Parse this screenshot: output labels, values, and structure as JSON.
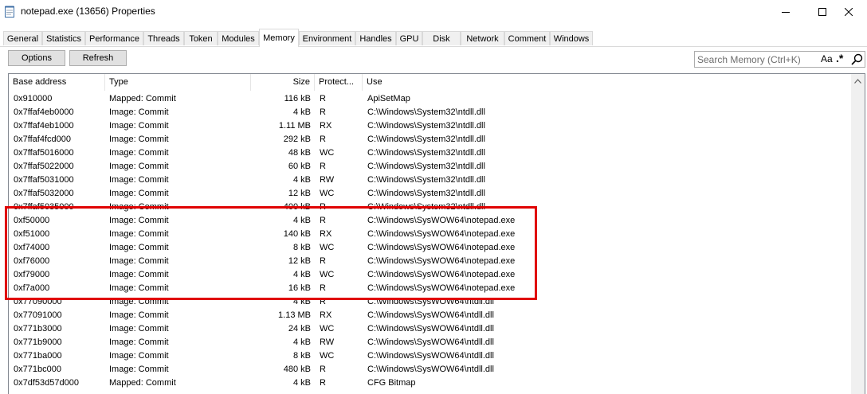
{
  "window": {
    "title": "notepad.exe (13656) Properties",
    "icon": "notepad-app-icon",
    "controls": [
      "minimize-icon",
      "maximize-icon",
      "close-icon"
    ]
  },
  "tabs": [
    {
      "label": "General"
    },
    {
      "label": "Statistics"
    },
    {
      "label": "Performance"
    },
    {
      "label": "Threads"
    },
    {
      "label": "Token"
    },
    {
      "label": "Modules"
    },
    {
      "label": "Memory",
      "active": true
    },
    {
      "label": "Environment"
    },
    {
      "label": "Handles"
    },
    {
      "label": "GPU"
    },
    {
      "label": "Disk"
    },
    {
      "label": "Network"
    },
    {
      "label": "Comment"
    },
    {
      "label": "Windows"
    }
  ],
  "toolbar": {
    "options_label": "Options",
    "refresh_label": "Refresh"
  },
  "search": {
    "placeholder": "Search Memory (Ctrl+K)",
    "case_toggle": "Aa",
    "regex_toggle": ".*"
  },
  "table": {
    "columns": [
      "Base address",
      "Type",
      "Size",
      "Protect...",
      "Use"
    ],
    "rows": [
      [
        "0x910000",
        "Mapped: Commit",
        "116 kB",
        "R",
        "ApiSetMap"
      ],
      [
        "0x7ffaf4eb0000",
        "Image: Commit",
        "4 kB",
        "R",
        "C:\\Windows\\System32\\ntdll.dll"
      ],
      [
        "0x7ffaf4eb1000",
        "Image: Commit",
        "1.11 MB",
        "RX",
        "C:\\Windows\\System32\\ntdll.dll"
      ],
      [
        "0x7ffaf4fcd000",
        "Image: Commit",
        "292 kB",
        "R",
        "C:\\Windows\\System32\\ntdll.dll"
      ],
      [
        "0x7ffaf5016000",
        "Image: Commit",
        "48 kB",
        "WC",
        "C:\\Windows\\System32\\ntdll.dll"
      ],
      [
        "0x7ffaf5022000",
        "Image: Commit",
        "60 kB",
        "R",
        "C:\\Windows\\System32\\ntdll.dll"
      ],
      [
        "0x7ffaf5031000",
        "Image: Commit",
        "4 kB",
        "RW",
        "C:\\Windows\\System32\\ntdll.dll"
      ],
      [
        "0x7ffaf5032000",
        "Image: Commit",
        "12 kB",
        "WC",
        "C:\\Windows\\System32\\ntdll.dll"
      ],
      [
        "0x7ffaf5035000",
        "Image: Commit",
        "400 kB",
        "R",
        "C:\\Windows\\System32\\ntdll.dll"
      ],
      [
        "0xf50000",
        "Image: Commit",
        "4 kB",
        "R",
        "C:\\Windows\\SysWOW64\\notepad.exe"
      ],
      [
        "0xf51000",
        "Image: Commit",
        "140 kB",
        "RX",
        "C:\\Windows\\SysWOW64\\notepad.exe"
      ],
      [
        "0xf74000",
        "Image: Commit",
        "8 kB",
        "WC",
        "C:\\Windows\\SysWOW64\\notepad.exe"
      ],
      [
        "0xf76000",
        "Image: Commit",
        "12 kB",
        "R",
        "C:\\Windows\\SysWOW64\\notepad.exe"
      ],
      [
        "0xf79000",
        "Image: Commit",
        "4 kB",
        "WC",
        "C:\\Windows\\SysWOW64\\notepad.exe"
      ],
      [
        "0xf7a000",
        "Image: Commit",
        "16 kB",
        "R",
        "C:\\Windows\\SysWOW64\\notepad.exe"
      ],
      [
        "0x77090000",
        "Image: Commit",
        "4 kB",
        "R",
        "C:\\Windows\\SysWOW64\\ntdll.dll"
      ],
      [
        "0x77091000",
        "Image: Commit",
        "1.13 MB",
        "RX",
        "C:\\Windows\\SysWOW64\\ntdll.dll"
      ],
      [
        "0x771b3000",
        "Image: Commit",
        "24 kB",
        "WC",
        "C:\\Windows\\SysWOW64\\ntdll.dll"
      ],
      [
        "0x771b9000",
        "Image: Commit",
        "4 kB",
        "RW",
        "C:\\Windows\\SysWOW64\\ntdll.dll"
      ],
      [
        "0x771ba000",
        "Image: Commit",
        "8 kB",
        "WC",
        "C:\\Windows\\SysWOW64\\ntdll.dll"
      ],
      [
        "0x771bc000",
        "Image: Commit",
        "480 kB",
        "R",
        "C:\\Windows\\SysWOW64\\ntdll.dll"
      ],
      [
        "0x7df53d57d000",
        "Mapped: Commit",
        "4 kB",
        "R",
        "CFG Bitmap"
      ]
    ]
  },
  "highlight_color": "#e00000"
}
